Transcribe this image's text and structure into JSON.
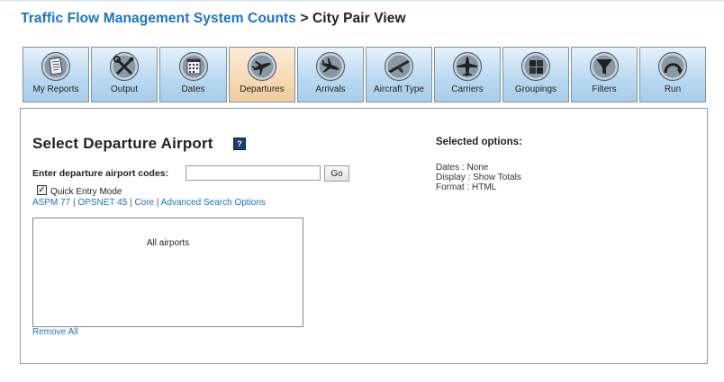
{
  "breadcrumb": {
    "root": "Traffic Flow Management System Counts",
    "separator": ">",
    "current": "City Pair View"
  },
  "tabs": [
    {
      "label": "My Reports",
      "icon": "document-icon"
    },
    {
      "label": "Output",
      "icon": "tools-icon"
    },
    {
      "label": "Dates",
      "icon": "calendar-icon"
    },
    {
      "label": "Departures",
      "icon": "departure-plane-icon",
      "active": true
    },
    {
      "label": "Arrivals",
      "icon": "arrival-plane-icon"
    },
    {
      "label": "Aircraft Type",
      "icon": "aircraft-wing-icon"
    },
    {
      "label": "Carriers",
      "icon": "airplane-icon"
    },
    {
      "label": "Groupings",
      "icon": "groupings-icon"
    },
    {
      "label": "Filters",
      "icon": "filter-icon"
    },
    {
      "label": "Run",
      "icon": "run-icon"
    }
  ],
  "main": {
    "heading": "Select Departure Airport",
    "help_icon": "?",
    "code_label": "Enter departure airport codes:",
    "code_value": "",
    "go_label": "Go",
    "quick_entry": {
      "label": "Quick Entry Mode",
      "checked": true
    },
    "links": [
      "ASPM 77",
      "OPSNET 45",
      "Core",
      "Advanced Search Options"
    ],
    "link_sep": "|",
    "list": [
      "All airports"
    ],
    "remove_all": "Remove All"
  },
  "selected": {
    "heading": "Selected options:",
    "lines": [
      "Dates : None",
      "Display : Show Totals",
      "Format : HTML"
    ]
  },
  "colors": {
    "link": "#1a73c7",
    "tab_gradient_top": "#e6f2fb",
    "tab_gradient_bottom": "#a7cce9",
    "active_tab": "#f6d9b3",
    "help_icon_bg": "#1d3f6e"
  }
}
